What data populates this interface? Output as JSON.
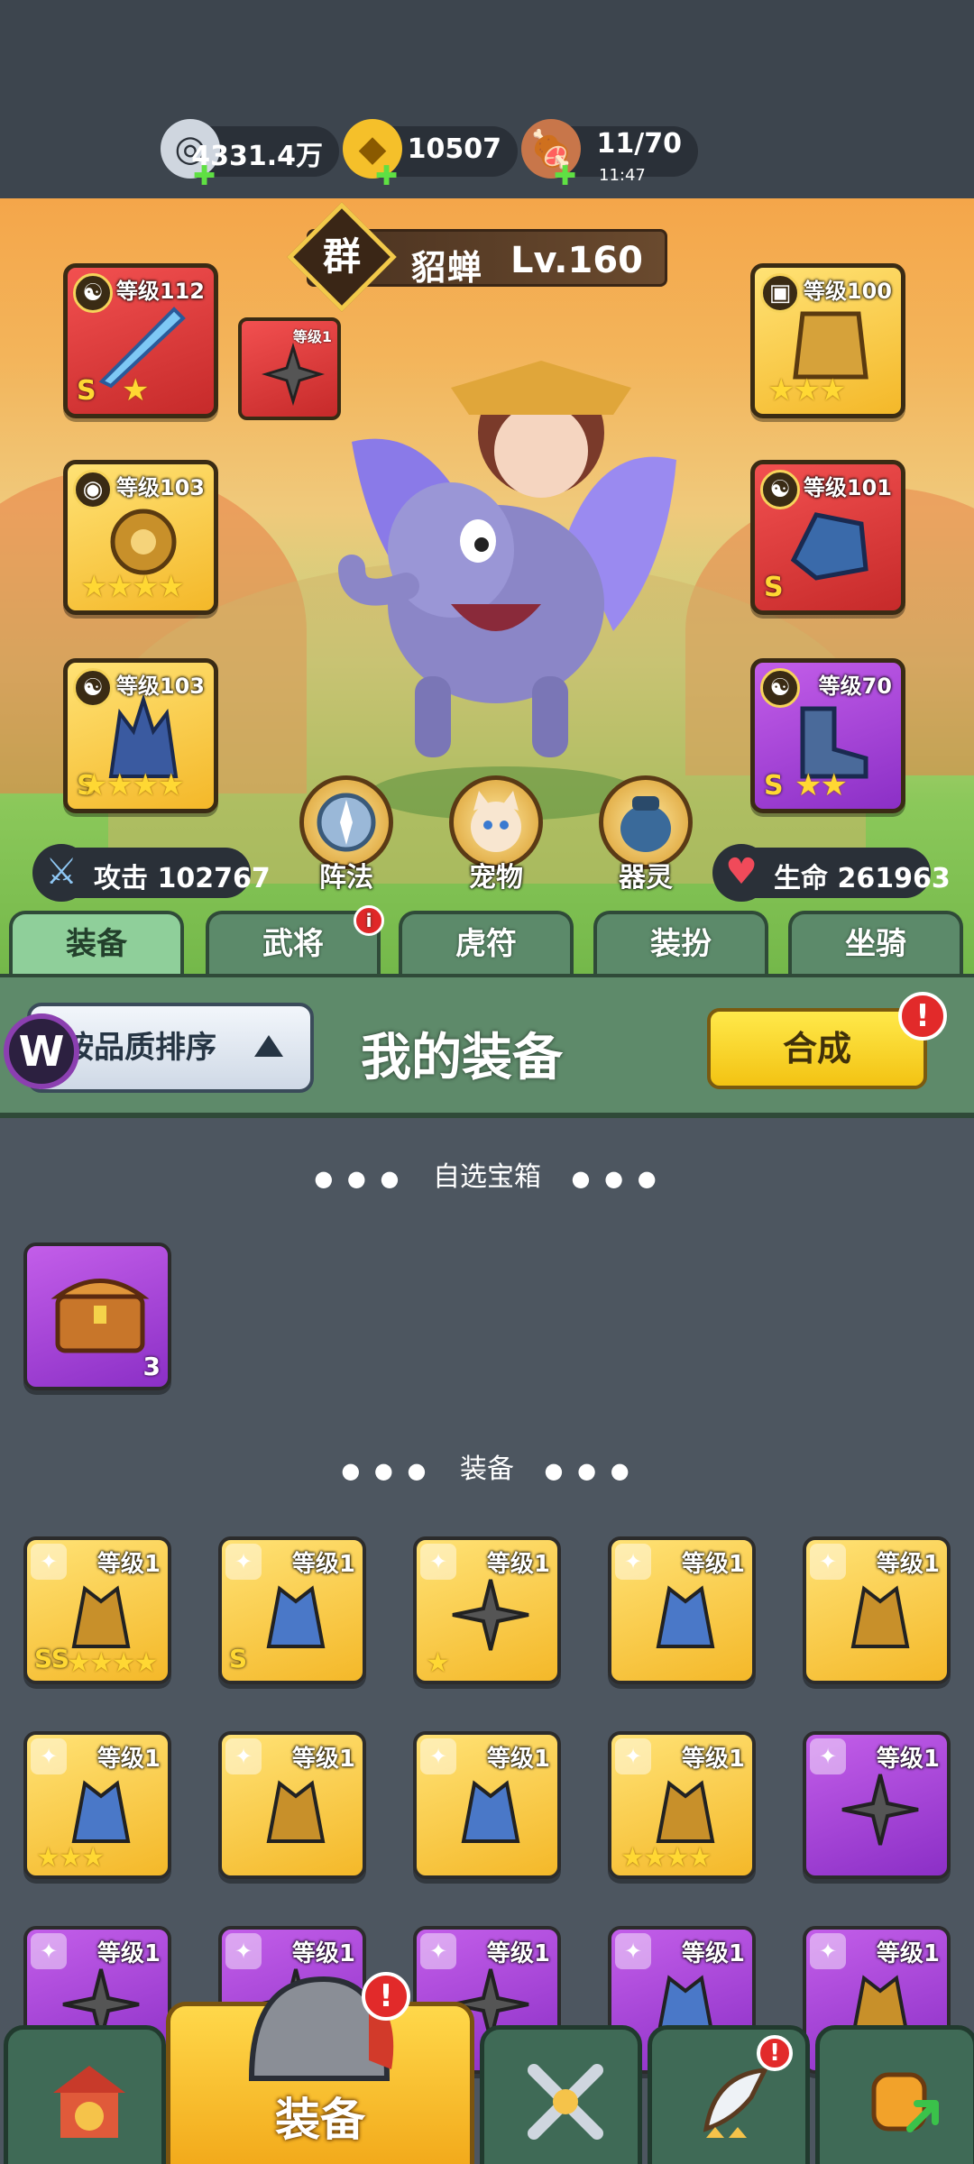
{
  "resources": {
    "silver": {
      "value": "4331.4万",
      "icon": "silver-coin-icon"
    },
    "gold": {
      "value": "10507",
      "icon": "gold-ingot-icon"
    },
    "stamina": {
      "value": "11/70",
      "timer": "11:47",
      "icon": "meat-drumstick-icon"
    }
  },
  "hero": {
    "faction": "群",
    "name": "貂蝉",
    "level": "Lv.160"
  },
  "slots": {
    "weapon": {
      "level": "等级112",
      "grade": "S",
      "stars": "★"
    },
    "accessory_small": {
      "level": "等级1"
    },
    "armor": {
      "level": "等级100",
      "stars": "★★★"
    },
    "amulet": {
      "level": "等级103",
      "stars": "★★★★"
    },
    "gauntlet": {
      "level": "等级101",
      "grade": "S"
    },
    "helmet": {
      "level": "等级103",
      "grade": "S",
      "stars": "★★★★"
    },
    "boots": {
      "level": "等级70",
      "grade": "S",
      "stars": "★★"
    }
  },
  "features": {
    "formation": "阵法",
    "pet": "宠物",
    "spirit": "器灵"
  },
  "stats": {
    "attack": "攻击 102767",
    "hp": "生命 261963"
  },
  "tabs": [
    "装备",
    "武将",
    "虎符",
    "装扮",
    "坐骑"
  ],
  "tab_alert": "i",
  "panel": {
    "sort_label": "按品质排序",
    "title": "我的装备",
    "synth_label": "合成",
    "alert": "!"
  },
  "sections": {
    "chest": "自选宝箱",
    "equip": "装备"
  },
  "chest_item": {
    "count": "3"
  },
  "inventory": [
    {
      "level": "等级1",
      "stars": "★★★★",
      "grade": "SS",
      "rarity": "gold"
    },
    {
      "level": "等级1",
      "stars": "",
      "grade": "S",
      "rarity": "gold"
    },
    {
      "level": "等级1",
      "stars": "★",
      "grade": "",
      "rarity": "gold"
    },
    {
      "level": "等级1",
      "stars": "",
      "grade": "",
      "rarity": "gold"
    },
    {
      "level": "等级1",
      "stars": "",
      "grade": "",
      "rarity": "gold"
    },
    {
      "level": "等级1",
      "stars": "★★★",
      "grade": "",
      "rarity": "gold"
    },
    {
      "level": "等级1",
      "stars": "",
      "grade": "",
      "rarity": "gold"
    },
    {
      "level": "等级1",
      "stars": "",
      "grade": "",
      "rarity": "gold"
    },
    {
      "level": "等级1",
      "stars": "★★★★",
      "grade": "",
      "rarity": "gold"
    },
    {
      "level": "等级1",
      "stars": "",
      "grade": "",
      "rarity": "purple"
    },
    {
      "level": "等级1",
      "stars": "",
      "grade": "",
      "rarity": "purple"
    },
    {
      "level": "等级1",
      "stars": "",
      "grade": "",
      "rarity": "purple"
    },
    {
      "level": "等级1",
      "stars": "",
      "grade": "",
      "rarity": "purple"
    },
    {
      "level": "等级1",
      "stars": "",
      "grade": "",
      "rarity": "purple"
    },
    {
      "level": "等级1",
      "stars": "",
      "grade": "",
      "rarity": "purple"
    }
  ],
  "nav": {
    "active_label": "装备",
    "alert": "!"
  },
  "colors": {
    "gold_item": "#f4b829",
    "purple_item": "#8b2fc6",
    "red_item": "#c62a2a",
    "tab_active": "#8fcf9a"
  }
}
